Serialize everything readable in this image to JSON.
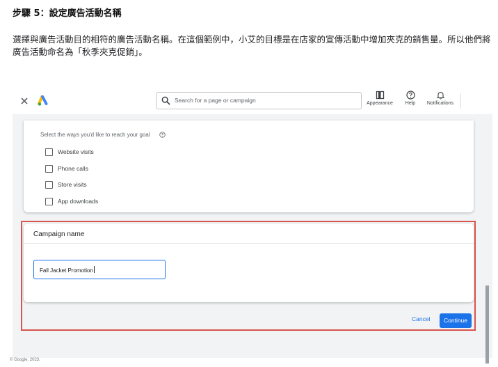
{
  "doc": {
    "heading": "步驟 5：設定廣告活動名稱",
    "paragraph": "選擇與廣告活動目的相符的廣告活動名稱。在這個範例中，小艾的目標是在店家的宣傳活動中增加夾克的銷售量。所以他們將廣告活動命名為「秋季夾克促銷」。"
  },
  "topbar": {
    "close_icon": "close-icon",
    "logo_icon": "google-ads-logo",
    "search_placeholder": "Search for a page or campaign",
    "tools": [
      {
        "label": "Appearance",
        "icon": "appearance-icon"
      },
      {
        "label": "Help",
        "icon": "help-icon"
      },
      {
        "label": "Notifications",
        "icon": "bell-icon"
      }
    ]
  },
  "goals": {
    "label": "Select the ways you'd like to reach your goal",
    "options": [
      {
        "label": "Website visits",
        "checked": false
      },
      {
        "label": "Phone calls",
        "checked": false
      },
      {
        "label": "Store visits",
        "checked": false
      },
      {
        "label": "App downloads",
        "checked": false
      }
    ]
  },
  "campaign": {
    "title": "Campaign name",
    "value": "Fall Jacket Promotion"
  },
  "actions": {
    "cancel": "Cancel",
    "continue": "Continue"
  },
  "footer": "© Google, 2023.",
  "colors": {
    "accent": "#1a73e8",
    "highlight": "#d9534f"
  }
}
